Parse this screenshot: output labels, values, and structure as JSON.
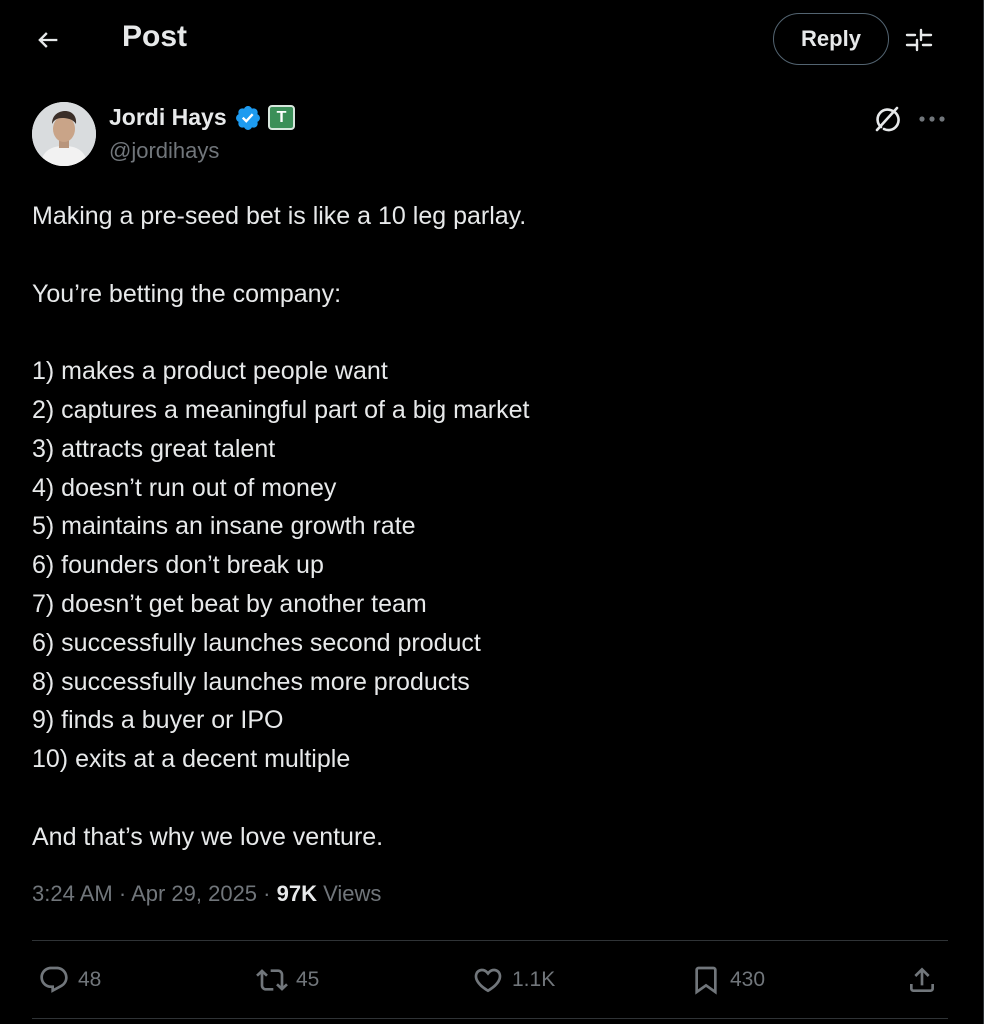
{
  "header": {
    "title": "Post",
    "reply_label": "Reply"
  },
  "author": {
    "name": "Jordi Hays",
    "handle": "@jordihays",
    "affiliation_badge": "T"
  },
  "post": {
    "lines": [
      "Making a pre-seed bet is like a 10 leg parlay.",
      "",
      "You’re betting the company:",
      "",
      "1) makes a product people want",
      "2) captures a meaningful part of a big market",
      "3) attracts great talent",
      "4) doesn’t run out of money",
      "5) maintains an insane growth rate",
      "6) founders don’t break up",
      "7) doesn’t get beat by another team",
      "6) successfully launches second product",
      "8) successfully launches more products",
      "9) finds a buyer or IPO",
      "10) exits at a decent multiple",
      "",
      "And that’s why we love venture."
    ],
    "time": "3:24 AM",
    "date": "Apr 29, 2025",
    "views_count": "97K",
    "views_label": "Views",
    "separator": " · "
  },
  "actions": {
    "replies": "48",
    "reposts": "45",
    "likes": "1.1K",
    "bookmarks": "430"
  },
  "colors": {
    "background": "#000000",
    "text": "#e7e9ea",
    "secondary": "#71767b",
    "verified": "#1d9bf0",
    "divider": "#2f3336"
  },
  "icons": [
    "back-arrow-icon",
    "filter-icon",
    "verified-icon",
    "grok-icon",
    "more-icon",
    "reply-icon",
    "repost-icon",
    "like-icon",
    "bookmark-icon",
    "share-icon"
  ]
}
